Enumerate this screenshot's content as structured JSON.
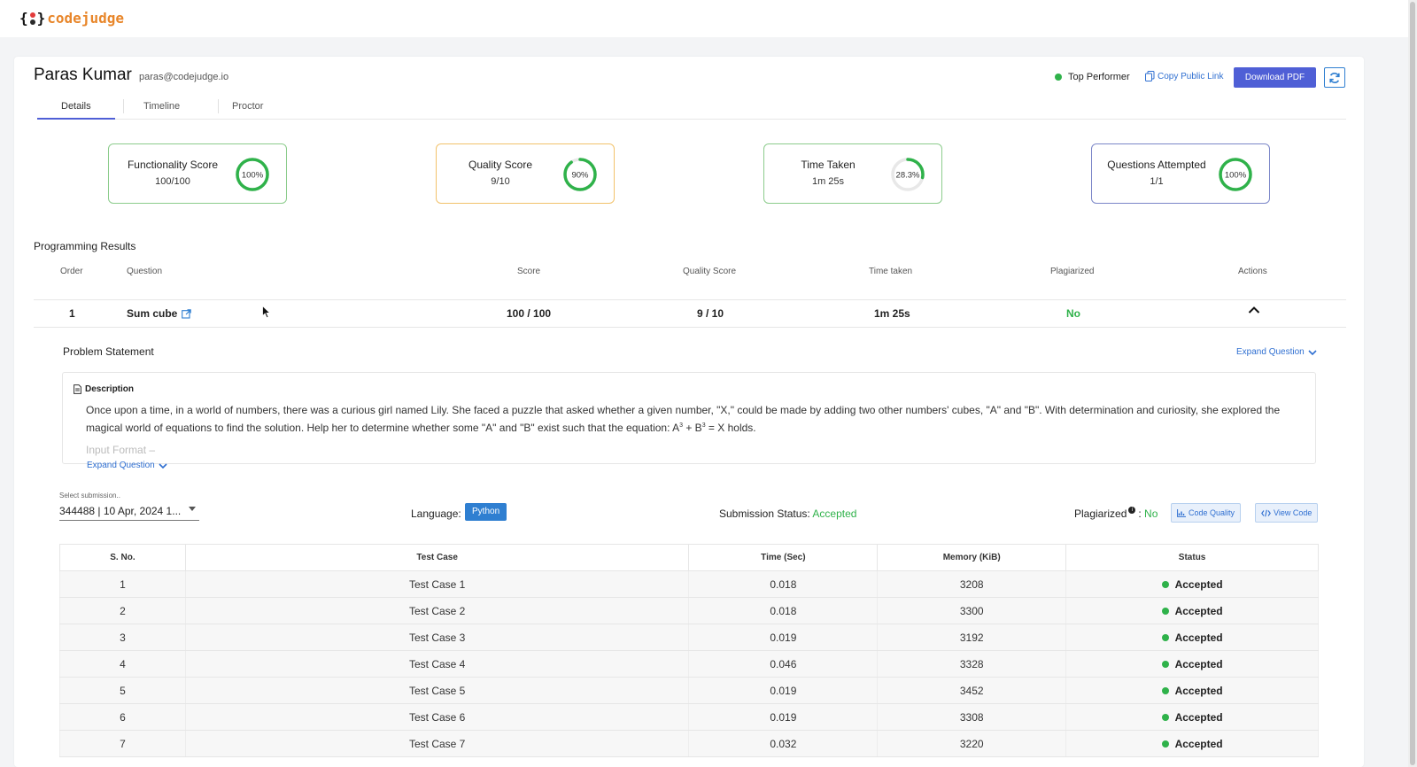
{
  "app": {
    "brand": "codejudge",
    "open_brace": "{",
    "close_brace": "}",
    "dot_colors": [
      "#e23b3b",
      "#2a2a2a"
    ]
  },
  "candidate": {
    "name": "Paras Kumar",
    "email": "paras@codejudge.io"
  },
  "header_actions": {
    "badge": "Top Performer",
    "copy_link": "Copy Public Link",
    "download": "Download PDF"
  },
  "tabs": [
    {
      "label": "Details",
      "active": true
    },
    {
      "label": "Timeline"
    },
    {
      "label": "Proctor"
    }
  ],
  "scores": [
    {
      "title": "Functionality Score",
      "value": "100/100",
      "percent_label": "100%",
      "percent": 100,
      "color": "#2fb24a",
      "border": "#8ccc8c"
    },
    {
      "title": "Quality Score",
      "value": "9/10",
      "percent_label": "90%",
      "percent": 90,
      "color": "#2fb24a",
      "border": "#f2c26b"
    },
    {
      "title": "Time Taken",
      "value": "1m 25s",
      "percent_label": "28.3%",
      "percent": 28.3,
      "color": "#2fb24a",
      "border": "#8ccc8c"
    },
    {
      "title": "Questions Attempted",
      "value": "1/1",
      "percent_label": "100%",
      "percent": 100,
      "color": "#2fb24a",
      "border": "#7b86c8"
    }
  ],
  "results": {
    "title": "Programming Results",
    "columns": [
      "Order",
      "Question",
      "Score",
      "Quality Score",
      "Time taken",
      "Plagiarized",
      "Actions"
    ],
    "row": {
      "order": "1",
      "question": "Sum cube",
      "score": "100 / 100",
      "quality": "9 / 10",
      "time": "1m 25s",
      "plagiarized": "No"
    }
  },
  "problem": {
    "title": "Problem Statement",
    "expand": "Expand Question",
    "desc_title": "Description",
    "desc_line1": "Once upon a time, in a world of numbers, there was a curious girl named Lily. She faced a puzzle that asked whether a given number, \"X,\" could be made by adding two other numbers' cubes, \"A\" and \"B\". With determination and curiosity, she explored the",
    "desc_line2_a": "magical world of equations to find the solution. Help her to determine whether some \"A\" and \"B\" exist such that the equation: A",
    "desc_sup1": "3",
    "desc_mid": " + B",
    "desc_sup2": "3",
    "desc_end": " = X holds.",
    "input_format": "Input Format –"
  },
  "submission": {
    "select_label": "Select submission..",
    "selected": "344488 | 10 Apr, 2024 1...",
    "language_label": "Language:",
    "language": "Python",
    "status_label": "Submission Status:",
    "status": "Accepted",
    "plag_label": "Plagiarized",
    "plag_value": "No",
    "code_quality": "Code Quality",
    "view_code": "View Code"
  },
  "testcases": {
    "columns": [
      "S. No.",
      "Test Case",
      "Time (Sec)",
      "Memory (KiB)",
      "Status"
    ],
    "rows": [
      [
        "1",
        "Test Case 1",
        "0.018",
        "3208",
        "Accepted"
      ],
      [
        "2",
        "Test Case 2",
        "0.018",
        "3300",
        "Accepted"
      ],
      [
        "3",
        "Test Case 3",
        "0.019",
        "3192",
        "Accepted"
      ],
      [
        "4",
        "Test Case 4",
        "0.046",
        "3328",
        "Accepted"
      ],
      [
        "5",
        "Test Case 5",
        "0.019",
        "3452",
        "Accepted"
      ],
      [
        "6",
        "Test Case 6",
        "0.019",
        "3308",
        "Accepted"
      ],
      [
        "7",
        "Test Case 7",
        "0.032",
        "3220",
        "Accepted"
      ]
    ]
  }
}
